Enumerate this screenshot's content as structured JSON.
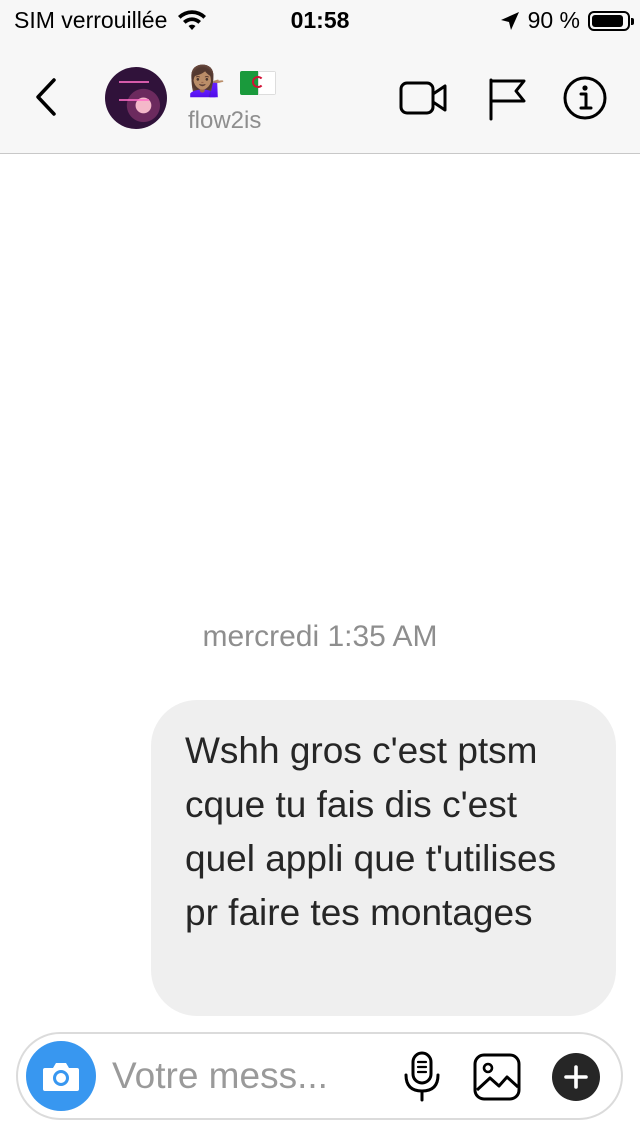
{
  "status_bar": {
    "carrier": "SIM verrouillée",
    "time": "01:58",
    "battery_percent_text": "90 %",
    "battery_level": 0.9
  },
  "header": {
    "emojis": "💁🏽‍♀️",
    "username": "flow2is",
    "icons": [
      "back-chevron-icon",
      "video-camera-icon",
      "flag-icon",
      "info-icon"
    ]
  },
  "conversation": {
    "timestamp": "mercredi 1:35 AM",
    "messages": [
      {
        "text": "Wshh gros c'est ptsm cque tu fais dis c'est quel appli que t'utilises pr faire tes montages"
      }
    ]
  },
  "composer": {
    "placeholder": "Votre mess...",
    "icons": [
      "camera-icon",
      "microphone-icon",
      "gallery-icon",
      "plus-icon"
    ],
    "camera_color": "#3897f0"
  }
}
